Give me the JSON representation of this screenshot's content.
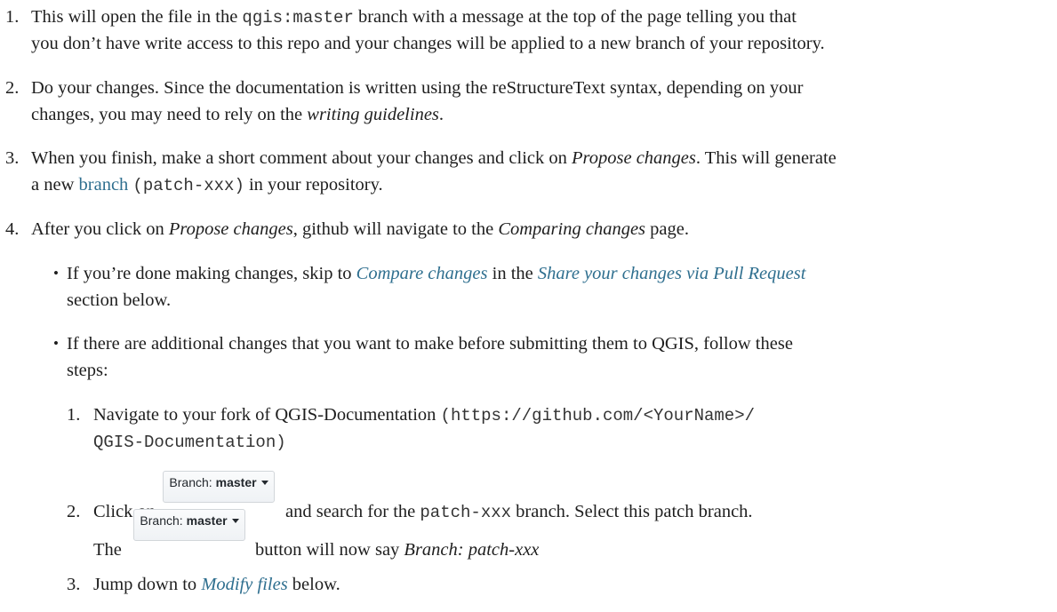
{
  "steps": [
    {
      "number": "1.",
      "line1_a": "This will open the file in the ",
      "line1_code": "qgis:master",
      "line1_b": " branch with a message at the top of the page telling you that",
      "line2": "you don’t have write access to this repo and your changes will be applied to a new branch of your repository."
    },
    {
      "number": "2.",
      "line1": "Do your changes. Since the documentation is written using the reStructureText syntax, depending on your",
      "line2_a": "changes, you may need to rely on the ",
      "line2_em": "writing guidelines",
      "line2_b": "."
    },
    {
      "number": "3.",
      "line1_a": "When you finish, make a short comment about your changes and click on ",
      "line1_em": "Propose changes",
      "line1_b": ". This will generate",
      "line2_a": "a new ",
      "line2_link": "branch",
      "line2_sp": " ",
      "line2_code": "(patch-xxx)",
      "line2_b": " in your repository."
    },
    {
      "number": "4.",
      "line1_a": "After you click on ",
      "line1_em1": "Propose changes",
      "line1_b": ", github will navigate to the ",
      "line1_em2": "Comparing changes",
      "line1_c": " page."
    }
  ],
  "bullets": [
    {
      "line1_a": "If you’re done making changes, skip to ",
      "line1_link1": "Compare changes",
      "line1_b": " in the ",
      "line1_link2": "Share your changes via Pull Request",
      "line2": "section below."
    },
    {
      "line1": "If there are additional changes that you want to make before submitting them to QGIS, follow these",
      "line2": "steps:"
    }
  ],
  "bullet_glyph": "•",
  "substeps": [
    {
      "number": "1.",
      "line1_a": "Navigate to your fork of QGIS-Documentation ",
      "line1_code": "(https://github.com/<YourName>/",
      "line2_code": "QGIS-Documentation)"
    },
    {
      "number": "2.",
      "line1_a": "Click on",
      "line1_b": "and search for the ",
      "line1_code": "patch-xxx",
      "line1_c": " branch. Select this patch branch.",
      "line2_a": "The",
      "line2_b": "button will now say ",
      "line2_em": "Branch: patch-xxx"
    },
    {
      "number": "3.",
      "line1_a": "Jump down to ",
      "line1_link": "Modify files",
      "line1_b": " below."
    }
  ],
  "branch_button": {
    "prefix": "Branch:",
    "name": "master",
    "icon": "caret-down-icon"
  },
  "colors": {
    "text": "#1e1e1e",
    "link": "#2f6f8f",
    "code": "#333333"
  }
}
